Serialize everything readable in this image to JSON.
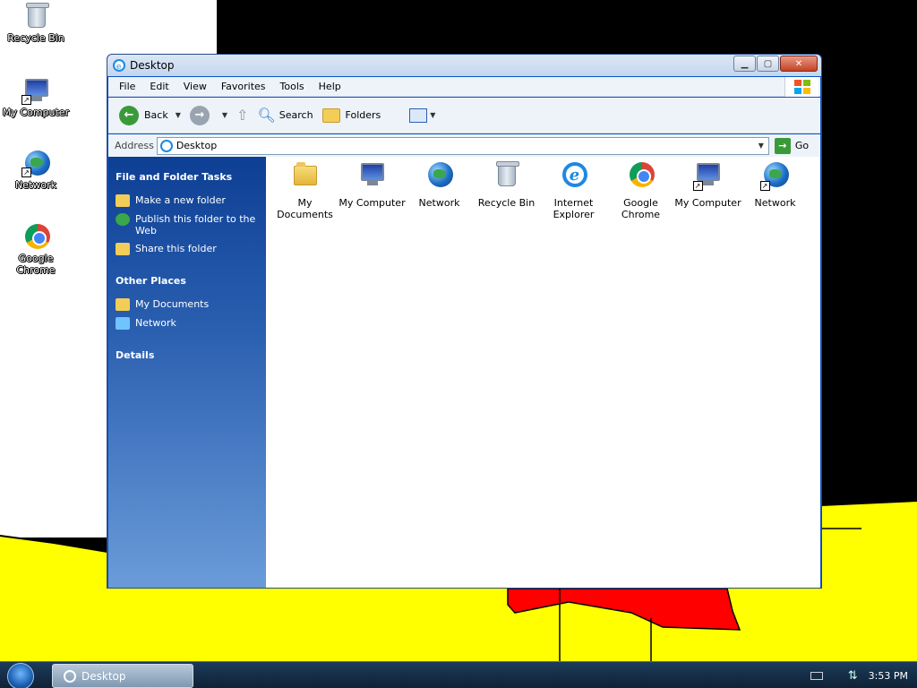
{
  "desktop": {
    "icons": [
      {
        "label": "Recycle Bin",
        "icon": "recycle-bin-icon"
      },
      {
        "label": "My Computer",
        "icon": "computer-icon"
      },
      {
        "label": "Network",
        "icon": "network-icon"
      },
      {
        "label": "Google Chrome",
        "icon": "chrome-icon"
      }
    ]
  },
  "window": {
    "title": "Desktop",
    "menu": [
      "File",
      "Edit",
      "View",
      "Favorites",
      "Tools",
      "Help"
    ],
    "toolbar": {
      "back": "Back",
      "search": "Search",
      "folders": "Folders"
    },
    "address": {
      "label": "Address",
      "value": "Desktop",
      "go": "Go"
    },
    "taskpane": {
      "file_tasks": {
        "title": "File and Folder Tasks",
        "items": [
          "Make a new folder",
          "Publish this folder to the Web",
          "Share this folder"
        ]
      },
      "other_places": {
        "title": "Other Places",
        "items": [
          "My Documents",
          "Network"
        ]
      },
      "details": {
        "title": "Details"
      }
    },
    "files": [
      {
        "label": "My Documents",
        "icon": "folder-icon"
      },
      {
        "label": "My Computer",
        "icon": "computer-icon"
      },
      {
        "label": "Network",
        "icon": "network-icon"
      },
      {
        "label": "Recycle Bin",
        "icon": "recycle-bin-icon"
      },
      {
        "label": "Internet Explorer",
        "icon": "internet-explorer-icon"
      },
      {
        "label": "Google Chrome",
        "icon": "chrome-icon"
      },
      {
        "label": "My Computer",
        "icon": "computer-icon"
      },
      {
        "label": "Network",
        "icon": "network-icon"
      }
    ]
  },
  "taskbar": {
    "task": "Desktop",
    "clock": "3:53 PM"
  },
  "colors": {
    "yellow": "#ffff00",
    "red": "#ff0000",
    "taskpane": "#2a5fb0"
  }
}
